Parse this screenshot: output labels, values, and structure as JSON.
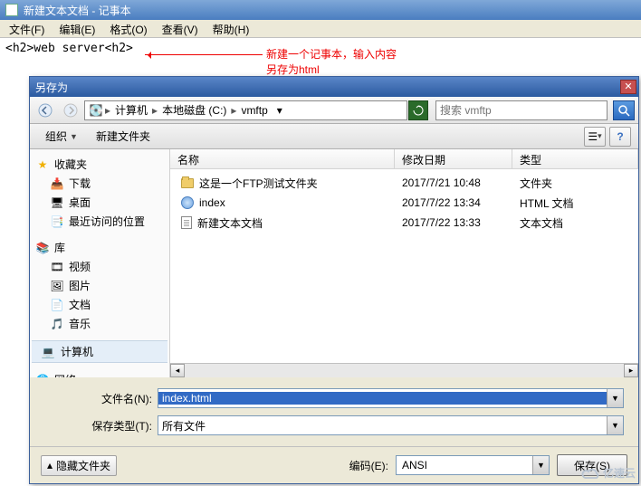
{
  "notepad": {
    "title": "新建文本文档 - 记事本",
    "menu": {
      "file": "文件(F)",
      "edit": "编辑(E)",
      "format": "格式(O)",
      "view": "查看(V)",
      "help": "帮助(H)"
    },
    "content": "<h2>web server<h2>"
  },
  "annotation": {
    "line1": "新建一个记事本，输入内容",
    "line2": "另存为html"
  },
  "saveas": {
    "title": "另存为",
    "breadcrumb": {
      "seg1": "计算机",
      "seg2": "本地磁盘 (C:)",
      "seg3": "vmftp"
    },
    "search_placeholder": "搜索 vmftp",
    "toolbar": {
      "organize": "组织",
      "newfolder": "新建文件夹"
    },
    "sidebar": {
      "favorites": "收藏夹",
      "downloads": "下载",
      "desktop": "桌面",
      "recent": "最近访问的位置",
      "libraries": "库",
      "videos": "视频",
      "pictures": "图片",
      "documents": "文档",
      "music": "音乐",
      "computer": "计算机",
      "network": "网络"
    },
    "columns": {
      "name": "名称",
      "date": "修改日期",
      "type": "类型"
    },
    "files": [
      {
        "icon": "folder",
        "name": "这是一个FTP测试文件夹",
        "date": "2017/7/21 10:48",
        "type": "文件夹"
      },
      {
        "icon": "html",
        "name": "index",
        "date": "2017/7/22 13:34",
        "type": "HTML 文档"
      },
      {
        "icon": "txt",
        "name": "新建文本文档",
        "date": "2017/7/22 13:33",
        "type": "文本文档"
      }
    ],
    "filename_label": "文件名(N):",
    "filename_value": "index.html",
    "filetype_label": "保存类型(T):",
    "filetype_value": "所有文件",
    "hide_folders": "隐藏文件夹",
    "encoding_label": "编码(E):",
    "encoding_value": "ANSI",
    "save_btn": "保存(S)"
  },
  "watermark": "亿速云"
}
